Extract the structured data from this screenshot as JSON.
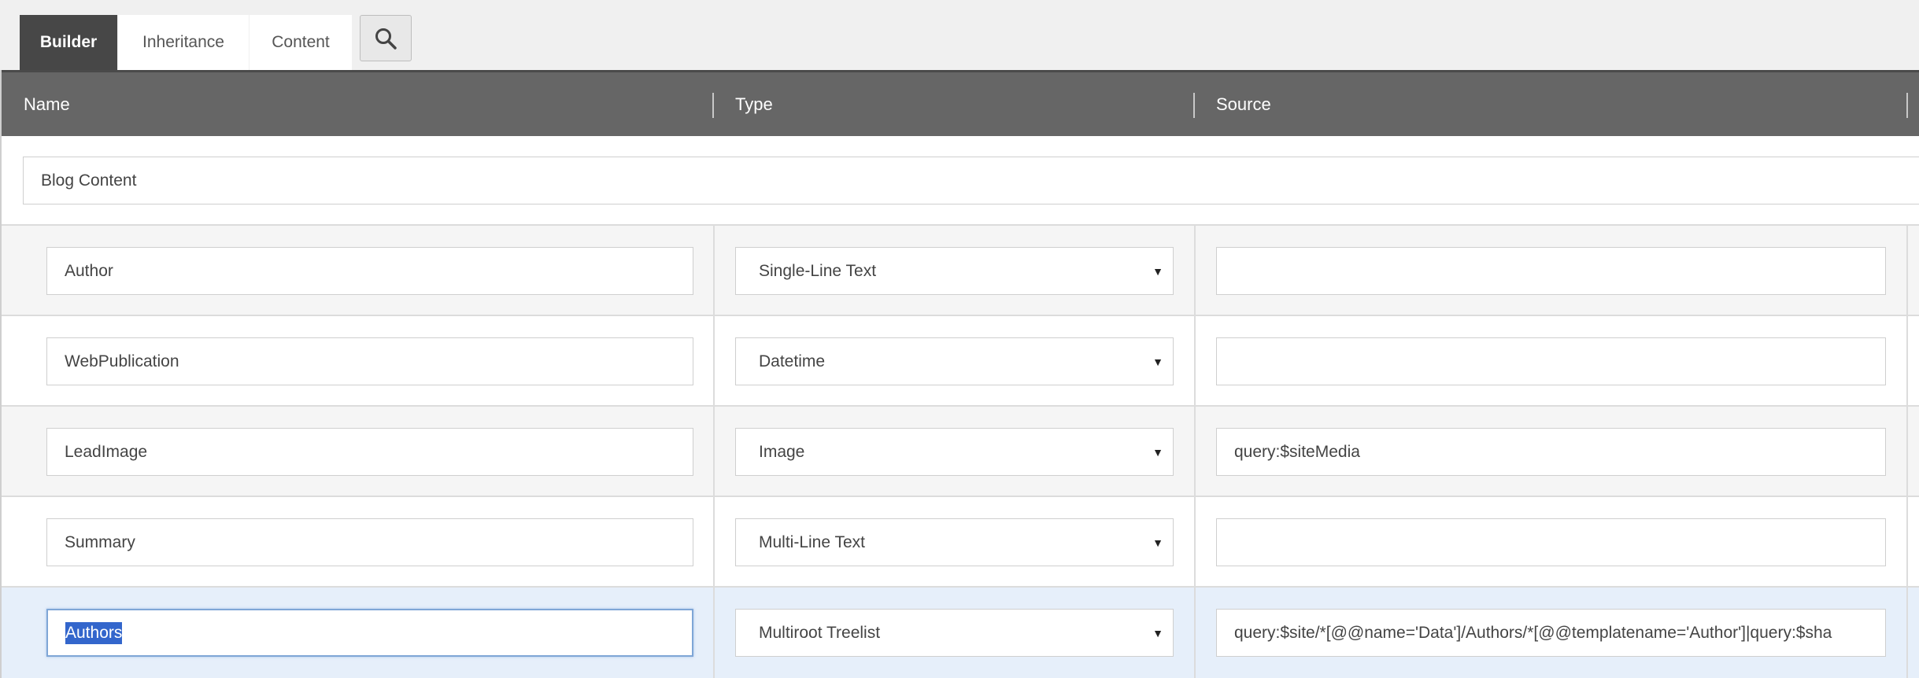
{
  "tabs": [
    {
      "label": "Builder",
      "active": true
    },
    {
      "label": "Inheritance",
      "active": false
    },
    {
      "label": "Content",
      "active": false
    }
  ],
  "search": {
    "icon": "search-icon"
  },
  "columns": {
    "name": "Name",
    "type": "Type",
    "source": "Source"
  },
  "section": {
    "name": "Blog Content"
  },
  "fields": [
    {
      "name": "Author",
      "type": "Single-Line Text",
      "source": ""
    },
    {
      "name": "WebPublication",
      "type": "Datetime",
      "source": ""
    },
    {
      "name": "LeadImage",
      "type": "Image",
      "source": "query:$siteMedia"
    },
    {
      "name": "Summary",
      "type": "Multi-Line Text",
      "source": ""
    },
    {
      "name": "Authors",
      "type": "Multiroot Treelist",
      "source": "query:$site/*[@@name='Data']/Authors/*[@@templatename='Author']|query:$sha",
      "selected": true
    }
  ],
  "colors": {
    "tab_active": "#474747",
    "header": "#666666",
    "selected_row": "#e6effa",
    "text_selection": "#3366cc"
  }
}
